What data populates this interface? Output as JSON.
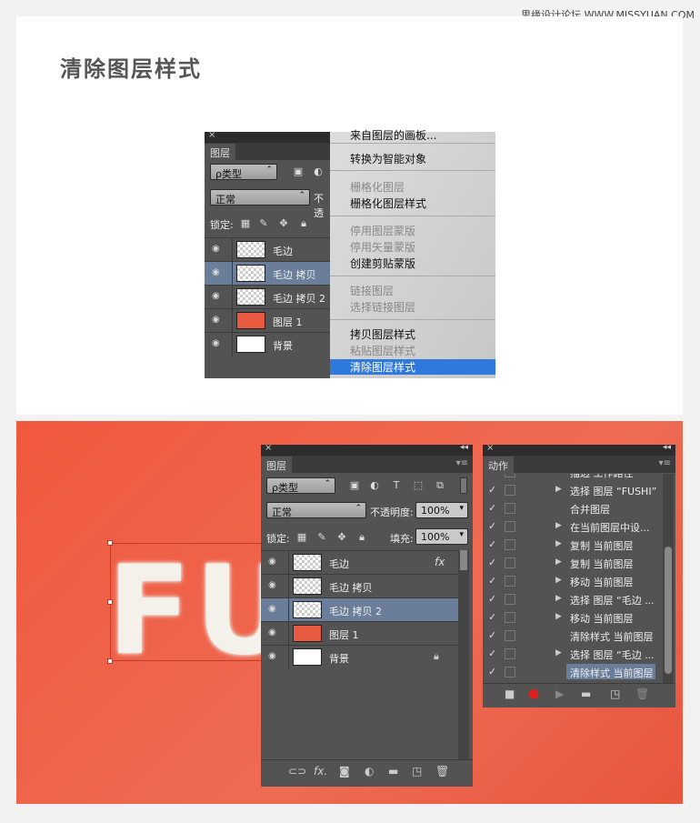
{
  "watermark": "思缘设计论坛 WWW.MISSYUAN.COM",
  "heading": "清除图层样式",
  "top_panel": {
    "tab": "图层",
    "filter": "ρ类型",
    "blend": "正常",
    "opacity_cut": "不透",
    "lock_label": "锁定:",
    "layers": [
      {
        "name": "毛边",
        "thumb": "checker",
        "active": false
      },
      {
        "name": "毛边 拷贝",
        "thumb": "checker",
        "active": true
      },
      {
        "name": "毛边 拷贝 2",
        "thumb": "checker",
        "active": false
      },
      {
        "name": "图层 1",
        "thumb": "red",
        "active": false
      },
      {
        "name": "背景",
        "thumb": "white",
        "active": false
      }
    ]
  },
  "context_menu": [
    {
      "label": "来自图层的画板...",
      "state": "normal"
    },
    {
      "label": "转换为智能对象",
      "state": "normal"
    },
    {
      "label": "栅格化图层",
      "state": "disabled"
    },
    {
      "label": "栅格化图层样式",
      "state": "normal"
    },
    {
      "label": "停用图层蒙版",
      "state": "disabled"
    },
    {
      "label": "停用矢量蒙版",
      "state": "disabled"
    },
    {
      "label": "创建剪贴蒙版",
      "state": "normal"
    },
    {
      "label": "链接图层",
      "state": "disabled"
    },
    {
      "label": "选择链接图层",
      "state": "disabled"
    },
    {
      "label": "拷贝图层样式",
      "state": "normal"
    },
    {
      "label": "粘贴图层样式",
      "state": "disabled"
    },
    {
      "label": "清除图层样式",
      "state": "highlighted"
    }
  ],
  "canvas_text": "FU",
  "bottom_layers": {
    "tab": "图层",
    "filter": "ρ类型",
    "blend": "正常",
    "opacity_label": "不透明度:",
    "opacity": "100%",
    "lock_label": "锁定:",
    "fill_label": "填充:",
    "fill": "100%",
    "fx": "fx",
    "layers": [
      {
        "name": "毛边",
        "thumb": "checker",
        "active": false
      },
      {
        "name": "毛边 拷贝",
        "thumb": "checker",
        "active": false
      },
      {
        "name": "毛边 拷贝 2",
        "thumb": "checker",
        "active": true
      },
      {
        "name": "图层 1",
        "thumb": "red",
        "active": false
      },
      {
        "name": "背景",
        "thumb": "white",
        "active": false
      }
    ]
  },
  "actions": {
    "tab": "动作",
    "items": [
      {
        "text": "描边 工作路径",
        "tri": true,
        "hl": false
      },
      {
        "text": "选择 图层 “FUSHI”",
        "tri": true,
        "hl": false
      },
      {
        "text": "合并图层",
        "tri": false,
        "hl": false
      },
      {
        "text": "在当前图层中设...",
        "tri": true,
        "hl": false
      },
      {
        "text": "复制 当前图层",
        "tri": true,
        "hl": false
      },
      {
        "text": "复制 当前图层",
        "tri": true,
        "hl": false
      },
      {
        "text": "移动 当前图层",
        "tri": true,
        "hl": false
      },
      {
        "text": "选择 图层 “毛边 ...",
        "tri": true,
        "hl": false
      },
      {
        "text": "移动 当前图层",
        "tri": true,
        "hl": false
      },
      {
        "text": "清除样式 当前图层",
        "tri": false,
        "hl": false
      },
      {
        "text": "选择 图层 “毛边 ...",
        "tri": true,
        "hl": false
      },
      {
        "text": "清除样式 当前图层",
        "tri": false,
        "hl": true
      }
    ]
  },
  "colors": {
    "accent": "#2f79dc",
    "active_row": "#6a7e99",
    "canvas": "#f0583d"
  }
}
